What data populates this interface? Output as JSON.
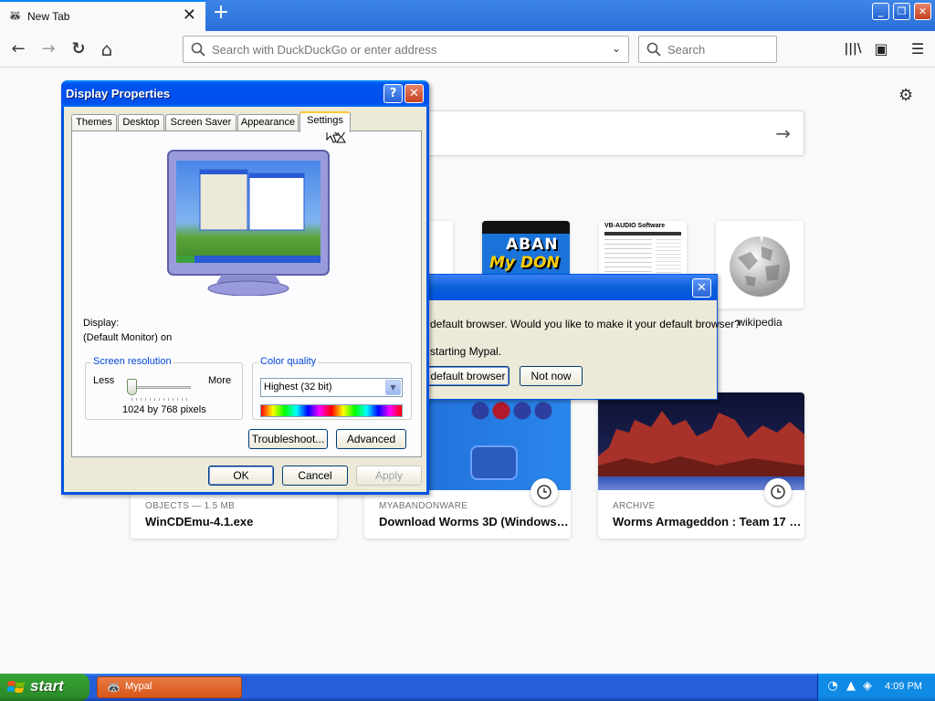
{
  "browser": {
    "tab": {
      "title": "New Tab",
      "close": "✕"
    },
    "newtab": "+",
    "window_controls": {
      "min": "_",
      "max": "❐",
      "close": "✕"
    },
    "nav": {
      "back": "←",
      "forward": "→",
      "reload": "↻",
      "home": "⌂"
    },
    "urlbar": {
      "placeholder": "Search with DuckDuckGo or enter address",
      "dropdown": "⌄"
    },
    "searchbar": {
      "placeholder": "Search"
    },
    "toolbar": {
      "library": "|||\\",
      "sidebar": "▣",
      "menu": "☰"
    }
  },
  "newtab_page": {
    "gear": "⚙",
    "search_arrow": "→",
    "top_sites": [
      {
        "label": "",
        "tile": "blank"
      },
      {
        "label": "",
        "tile": "mypal-aban"
      },
      {
        "label": "",
        "tile": "vb-audio"
      },
      {
        "label": "wikipedia",
        "tile": "wikipedia"
      }
    ],
    "vb_audio_banner": "VB-AUDIO Software",
    "aban_logo": {
      "line1": "ABAN",
      "line2": "My DON"
    },
    "highlights": [
      {
        "source": "OBJECTS — 1.5 MB",
        "title": "WinCDEmu-4.1.exe"
      },
      {
        "source": "MYABANDONWARE",
        "title": "Download Worms 3D (Windows…"
      },
      {
        "source": "ARCHIVE",
        "title": "Worms Armageddon : Team 17 …"
      }
    ]
  },
  "default_browser_dialog": {
    "message": "default browser. Would you like to make it your default browser?",
    "message2": "starting Mypal.",
    "yes_button": "default browser",
    "no_button": "Not now",
    "close": "✕"
  },
  "display_properties": {
    "title": "Display Properties",
    "help": "?",
    "close": "✕",
    "tabs": [
      "Themes",
      "Desktop",
      "Screen Saver",
      "Appearance",
      "Settings"
    ],
    "active_tab": "Settings",
    "display_label": "Display:",
    "display_value": "(Default Monitor) on",
    "screen_resolution": {
      "legend": "Screen resolution",
      "less": "Less",
      "more": "More",
      "value": "1024 by 768 pixels",
      "slider_position": 0
    },
    "color_quality": {
      "legend": "Color quality",
      "selected": "Highest (32 bit)"
    },
    "buttons": {
      "troubleshoot": "Troubleshoot...",
      "advanced": "Advanced",
      "ok": "OK",
      "cancel": "Cancel",
      "apply": "Apply"
    }
  },
  "taskbar": {
    "start": "start",
    "task": "Mypal",
    "clock": "4:09 PM"
  },
  "colors": {
    "xp_title_blue": "#0054e3",
    "xp_start_green": "#2b8b28",
    "taskbar_blue": "#245edb",
    "firefox_accent": "#0a84ff"
  }
}
